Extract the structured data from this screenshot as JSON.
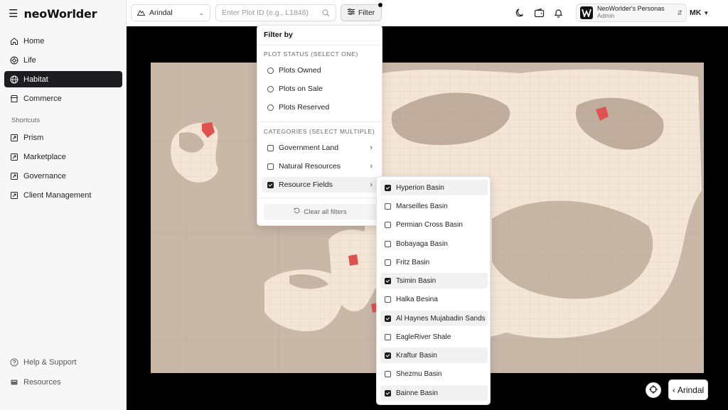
{
  "app": {
    "logo": "neoWorlder"
  },
  "sidebar": {
    "items": [
      {
        "label": "Home",
        "icon": "home-icon",
        "active": false
      },
      {
        "label": "Life",
        "icon": "life-icon",
        "active": false
      },
      {
        "label": "Habitat",
        "icon": "globe-icon",
        "active": true
      },
      {
        "label": "Commerce",
        "icon": "store-icon",
        "active": false
      }
    ],
    "shortcuts_title": "Shortcuts",
    "shortcuts": [
      {
        "label": "Prism",
        "icon": "external-link-icon"
      },
      {
        "label": "Marketplace",
        "icon": "external-link-icon"
      },
      {
        "label": "Governance",
        "icon": "external-link-icon"
      },
      {
        "label": "Client Management",
        "icon": "external-link-icon"
      }
    ],
    "bottom": [
      {
        "label": "Help & Support",
        "icon": "help-icon"
      },
      {
        "label": "Resources",
        "icon": "resources-icon"
      }
    ]
  },
  "topbar": {
    "location": "Arindal",
    "plot_search_placeholder": "Enter Plot ID (e.g., L1848)",
    "filter_label": "Filter",
    "account_name": "NeoWorlder's Personas",
    "account_role": "Admin",
    "user_initials": "MK"
  },
  "filter_panel": {
    "title": "Filter by",
    "status_title": "PLOT STATUS (SELECT ONE)",
    "status_options": [
      "Plots Owned",
      "Plots on Sale",
      "Plots Reserved"
    ],
    "categories_title": "CATEGORIES (SELECT MULTIPLE)",
    "categories": [
      {
        "label": "Government Land",
        "checked": false
      },
      {
        "label": "Natural Resources",
        "checked": false
      },
      {
        "label": "Resource Fields",
        "checked": true
      }
    ],
    "clear_label": "Clear all filters"
  },
  "resource_fields": [
    {
      "label": "Hyperion Basin",
      "checked": true
    },
    {
      "label": "Marseilles Basin",
      "checked": false
    },
    {
      "label": "Permian Cross Basin",
      "checked": false
    },
    {
      "label": "Bobayaga Basin",
      "checked": false
    },
    {
      "label": "Fritz Basin",
      "checked": false
    },
    {
      "label": "Tsimin Basin",
      "checked": true
    },
    {
      "label": "Halka Besina",
      "checked": false
    },
    {
      "label": "Al Haynes Mujabadin Sands",
      "checked": true
    },
    {
      "label": "EagleRiver Shale",
      "checked": false
    },
    {
      "label": "Kraftur Basin",
      "checked": true
    },
    {
      "label": "Shezmu Basin",
      "checked": false
    },
    {
      "label": "Bainne Basin",
      "checked": true
    }
  ],
  "map_controls": {
    "back_label": "Arindal"
  },
  "colors": {
    "accent": "#1d1d1f",
    "map_bg": "#c9b8a8",
    "land": "#f4e6d6",
    "highlight": "#e05252"
  }
}
